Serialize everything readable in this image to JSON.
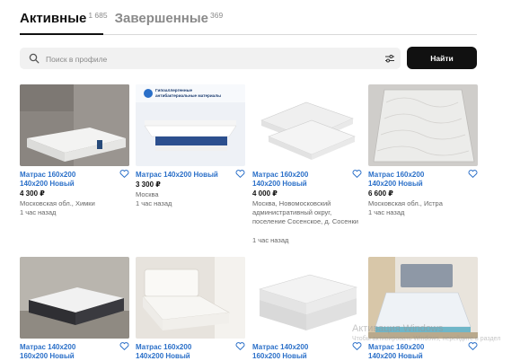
{
  "tabs": [
    {
      "label": "Активные",
      "count": "1 685"
    },
    {
      "label": "Завершенные",
      "count": "369"
    }
  ],
  "search": {
    "placeholder": "Поиск в профиле",
    "value": "",
    "button_label": "Найти"
  },
  "listings": [
    {
      "title_line1": "Матрас 160x200",
      "title_line2": "140x200 Новый",
      "price": "4 300 ₽",
      "location": "Московская обл., Химки",
      "time": "1 час назад"
    },
    {
      "title_line1": "Матрас 140x200 Новый",
      "title_line2": "",
      "price": "3 300 ₽",
      "location": "Москва",
      "time": "1 час назад",
      "photo_banner_line1": "Гипоаллергенные",
      "photo_banner_line2": "антибактериальные материалы"
    },
    {
      "title_line1": "Матрас 160x200",
      "title_line2": "140x200 Новый",
      "price": "4 000 ₽",
      "location": "Москва, Новомосковский административный округ, поселение Сосенское, д. Сосенки",
      "time": "1 час назад"
    },
    {
      "title_line1": "Матрас 160x200",
      "title_line2": "140x200 Новый",
      "price": "6 600 ₽",
      "location": "Московская обл., Истра",
      "time": "1 час назад"
    },
    {
      "title_line1": "Матрас 140x200",
      "title_line2": "160x200 Новый"
    },
    {
      "title_line1": "Матрас 160x200",
      "title_line2": "140x200 Новый"
    },
    {
      "title_line1": "Матрас 140x200",
      "title_line2": "160x200 Новый"
    },
    {
      "title_line1": "Матрас 160x200",
      "title_line2": "140x200 Новый"
    }
  ],
  "watermark": {
    "line1": "Активация Windows",
    "line2": "Чтобы активировать Windows, перейдите в раздел"
  },
  "colors": {
    "accent": "#2a6fc8",
    "button_bg": "#111111",
    "search_bg": "#f1f1f1"
  }
}
